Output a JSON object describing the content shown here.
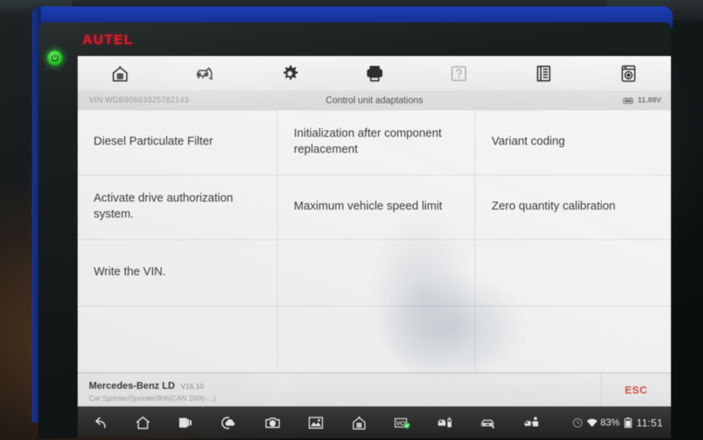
{
  "device": {
    "brand": "AUTEL",
    "brand_color": "#e8192a",
    "bezel_color": "#1b3fb8",
    "power_led_color": "#2ecb2a"
  },
  "toolbar": {
    "items": [
      {
        "name": "home-icon",
        "label": "Home",
        "disabled": false
      },
      {
        "name": "vehicle-swap-icon",
        "label": "Vehicle Swap",
        "disabled": false
      },
      {
        "name": "gear-icon",
        "label": "Settings",
        "disabled": false
      },
      {
        "name": "printer-icon",
        "label": "Print",
        "disabled": false
      },
      {
        "name": "help-icon",
        "label": "Help",
        "disabled": true
      },
      {
        "name": "save-icon",
        "label": "Save",
        "disabled": false
      },
      {
        "name": "data-logging-icon",
        "label": "Data Logging",
        "disabled": false
      }
    ]
  },
  "infobar": {
    "vin": "VIN:WDB90663325782143",
    "title": "Control unit adaptations",
    "voltage": "11.88V",
    "battery_icon": "battery-icon"
  },
  "menu": {
    "cells": [
      "Diesel Particulate Filter",
      "Initialization after component replacement",
      "Variant coding",
      "Activate drive authorization system.",
      "Maximum vehicle speed limit",
      "Zero quantity calibration",
      "Write the VIN.",
      "",
      "",
      "",
      "",
      ""
    ]
  },
  "footer": {
    "vehicle_name": "Mercedes-Benz LD",
    "version": "V16.10",
    "vehicle_sub": "Car:Sprinter/Sprinter/906(CAN 2006-...)",
    "esc_label": "ESC",
    "esc_color": "#d9523f"
  },
  "navbar": {
    "icons": [
      "back-icon",
      "home-icon",
      "recent-apps-icon",
      "cloud-icon",
      "camera-icon",
      "screenshot-icon",
      "house-icon",
      "vci-icon",
      "remote-vehicle-icon",
      "car-icon",
      "diagnostics-icon"
    ],
    "wifi_icon": "wifi-icon",
    "battery_percent": "83%",
    "battery_icon": "battery-icon",
    "clock": "11:51"
  }
}
